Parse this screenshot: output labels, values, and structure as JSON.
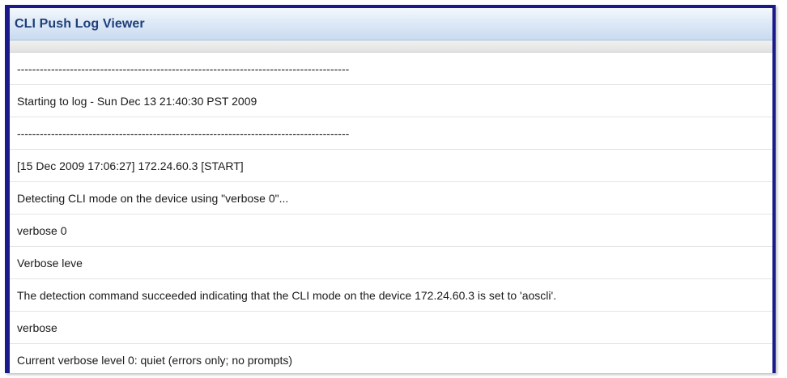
{
  "window": {
    "title": "CLI Push Log Viewer"
  },
  "log": {
    "rows": [
      "----------------------------------------------------------------------------------------",
      "Starting to log - Sun Dec 13 21:40:30 PST 2009",
      "----------------------------------------------------------------------------------------",
      "[15 Dec 2009 17:06:27] 172.24.60.3 [START]",
      "Detecting CLI mode on the device using \"verbose 0\"...",
      "verbose 0",
      "Verbose leve",
      "The detection command succeeded indicating that the CLI mode on the device 172.24.60.3 is set to 'aoscli'.",
      "verbose",
      "Current verbose level 0: quiet (errors only; no prompts)"
    ]
  }
}
